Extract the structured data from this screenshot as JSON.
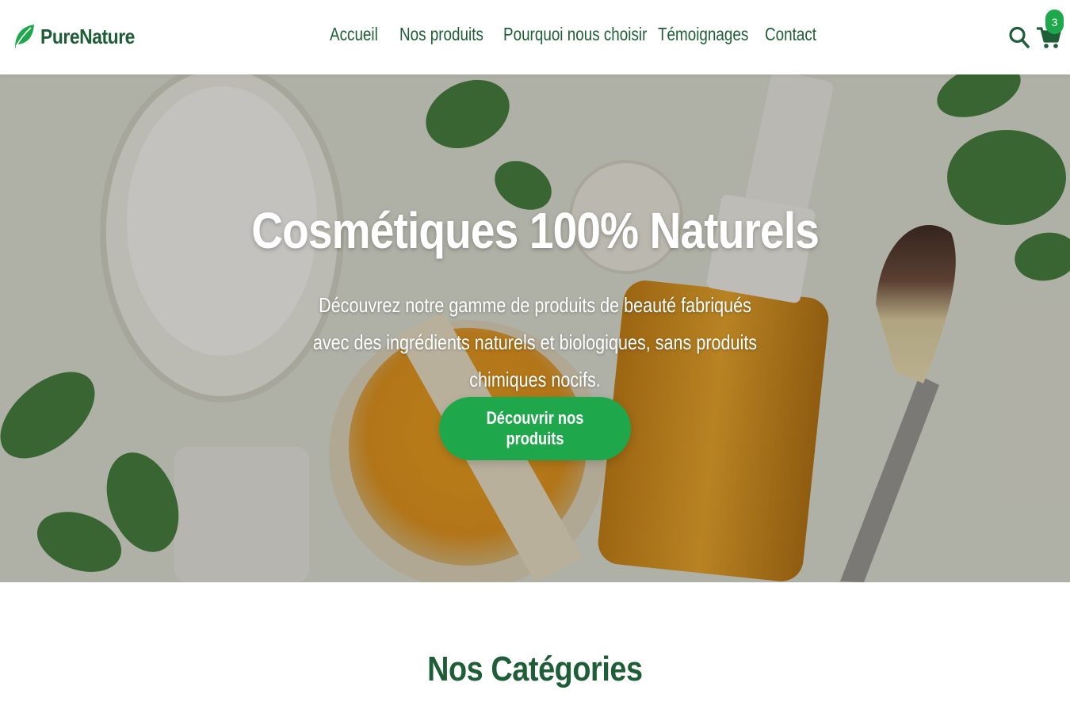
{
  "brand": {
    "name": "PureNature",
    "icon": "leaf-icon",
    "color": "#1d5e36",
    "accent": "#1fa84b"
  },
  "nav": {
    "items": [
      {
        "label": "Accueil"
      },
      {
        "label": "Nos produits"
      },
      {
        "label": "Pourquoi nous choisir"
      },
      {
        "label": "Témoignages"
      },
      {
        "label": "Contact"
      }
    ]
  },
  "header_actions": {
    "search_icon": "search-icon",
    "cart_icon": "cart-icon",
    "cart_count": "3"
  },
  "hero": {
    "title": "Cosmétiques 100% Naturels",
    "subtitle": "Découvrez notre gamme de produits de beauté fabriqués avec des ingrédients naturels et biologiques, sans produits chimiques nocifs.",
    "cta_label": "Découvrir nos produits"
  },
  "categories": {
    "title": "Nos Catégories"
  }
}
